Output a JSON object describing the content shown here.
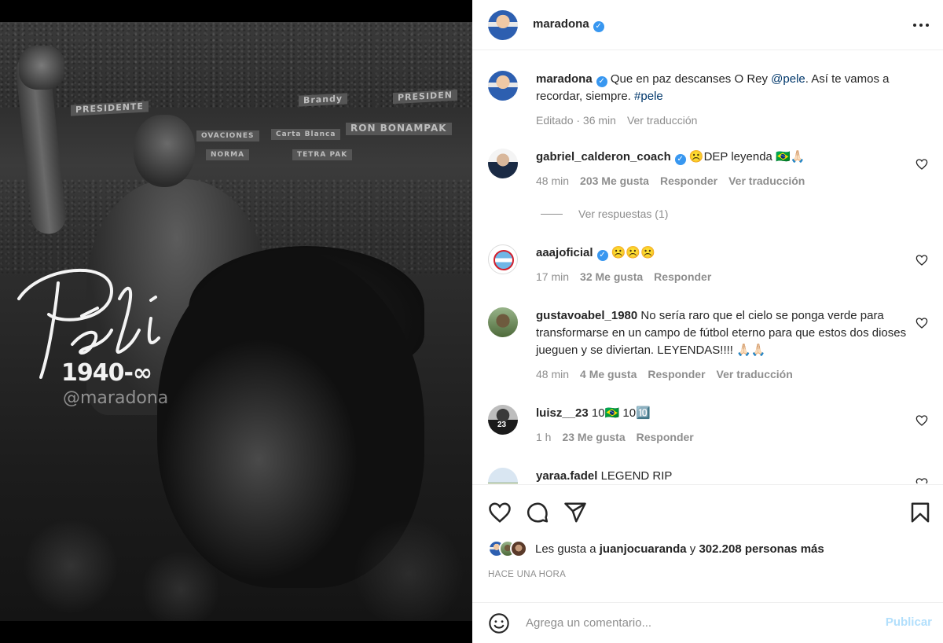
{
  "media": {
    "signature": "Pelé",
    "years": "1940-∞",
    "watermark": "@maradona",
    "banners": [
      "PRESIDENTE",
      "Brandy",
      "PRESIDEN",
      "OVACIONES",
      "Carta Blanca",
      "RON BONAMPAK",
      "TETRA PAK",
      "NORMA"
    ]
  },
  "header": {
    "username": "maradona",
    "verified": true,
    "more_icon": "more-horizontal-icon"
  },
  "caption": {
    "username": "maradona",
    "text_before": "Que en paz descanses O Rey ",
    "mention": "@pele",
    "text_after": ". Así te vamos a recordar, siempre. ",
    "hashtag": "#pele",
    "edited": "Editado · 36 min",
    "translate": "Ver traducción"
  },
  "comments": [
    {
      "username": "gabriel_calderon_coach",
      "verified": true,
      "text": "☹️DEP leyenda 🇧🇷🙏🏻",
      "time": "48 min",
      "likes": "203 Me gusta",
      "reply": "Responder",
      "translate": "Ver traducción",
      "replies": "Ver respuestas (1)"
    },
    {
      "username": "aaajoficial",
      "verified": true,
      "text": "☹️☹️☹️",
      "time": "17 min",
      "likes": "32 Me gusta",
      "reply": "Responder"
    },
    {
      "username": "gustavoabel_1980",
      "verified": false,
      "text": "No sería raro que el cielo se ponga verde para transformarse en un campo de fútbol eterno para que estos dos dioses jueguen y se diviertan. LEYENDAS!!!! 🙏🏻🙏🏻",
      "time": "48 min",
      "likes": "4 Me gusta",
      "reply": "Responder",
      "translate": "Ver traducción"
    },
    {
      "username": "luisz__23",
      "verified": false,
      "text": "10🇧🇷 10🔟",
      "time": "1 h",
      "likes": "23 Me gusta",
      "reply": "Responder"
    },
    {
      "username": "yaraa.fadel",
      "verified": false,
      "text": "LEGEND RIP"
    }
  ],
  "actions": {
    "like_icon": "heart-icon",
    "comment_icon": "comment-icon",
    "share_icon": "send-icon",
    "save_icon": "bookmark-icon"
  },
  "likes": {
    "prefix": "Les gusta a ",
    "user": "juanjocuaranda",
    "middle": " y ",
    "count": "302.208 personas más"
  },
  "timestamp": "HACE UNA HORA",
  "comment_box": {
    "emoji_icon": "emoji-icon",
    "placeholder": "Agrega un comentario...",
    "publish": "Publicar"
  },
  "colors": {
    "verified": "#3897f0",
    "link": "#00376b",
    "muted": "#8e8e8e",
    "publish_disabled": "#b2dffc"
  }
}
